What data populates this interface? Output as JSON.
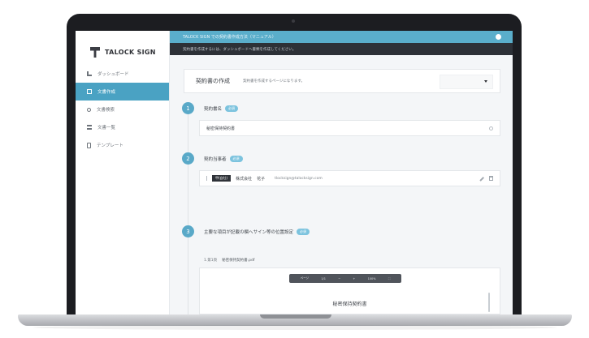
{
  "app": {
    "logo_text": "TALOCK SIGN"
  },
  "topbar": {
    "title": "TALOCK SIGN での契約書作成方法（マニュアル）"
  },
  "subbar": {
    "text": "契約書を作成するには、ダッシュボードへ書類を作成してください。"
  },
  "sidebar": {
    "items": [
      {
        "label": "ダッシュボード",
        "icon": "dashboard-icon"
      },
      {
        "label": "文書作成",
        "icon": "document-icon"
      },
      {
        "label": "文書検索",
        "icon": "search-icon"
      },
      {
        "label": "文書一覧",
        "icon": "list-icon"
      },
      {
        "label": "テンプレート",
        "icon": "template-icon"
      }
    ]
  },
  "header": {
    "title": "契約書の作成",
    "subtitle": "契約書を作成するページになります。",
    "template_select": ""
  },
  "steps": [
    {
      "number": "1",
      "label": "契約書名",
      "badge": "必須"
    },
    {
      "number": "2",
      "label": "契約当事者",
      "badge": "必須"
    },
    {
      "number": "3",
      "label": "主要な項目が記載の欄へサイン等の位置設定",
      "badge": "必須"
    }
  ],
  "contract_name": {
    "value": "秘密保持契約書"
  },
  "signer": {
    "party": "甲(自社)",
    "company": "株式会社",
    "name": "花子",
    "email": "tlocksign@talocksign.com"
  },
  "file_tab": {
    "label": "1.第1頁",
    "file_name": "秘密保持契約書.pdf"
  },
  "doc_viewer": {
    "toolbar": [
      "ページ",
      "1/1",
      "−",
      "+",
      "100%",
      "⛶"
    ],
    "doc_title": "秘密保持契約書"
  },
  "colors": {
    "accent": "#5aaecb",
    "active_nav": "#4aa2c3",
    "subbar": "#2d3137"
  }
}
